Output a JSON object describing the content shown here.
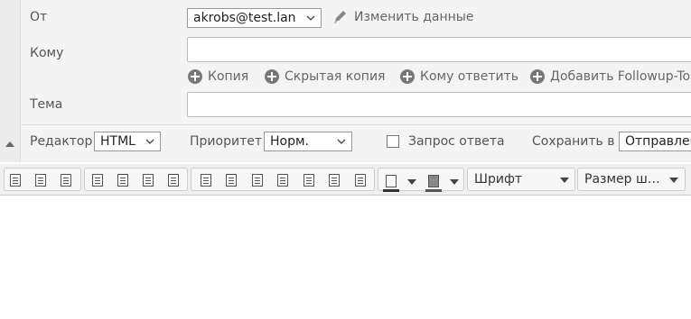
{
  "from": {
    "label": "От",
    "value": "akrobs@test.lan",
    "edit_link": "Изменить данные"
  },
  "to": {
    "label": "Кому",
    "value": ""
  },
  "recipient_links": [
    "Копия",
    "Скрытая копия",
    "Кому ответить",
    "Добавить Followup-To"
  ],
  "subject": {
    "label": "Тема",
    "value": ""
  },
  "options": {
    "editor_label": "Редактор",
    "editor_value": "HTML",
    "priority_label": "Приоритет",
    "priority_value": "Норм.",
    "receipt_label": "Запрос ответа",
    "receipt_checked": false,
    "save_label": "Сохранить в",
    "save_value": "Отправленные"
  },
  "toolbar": {
    "font_label": "Шрифт",
    "size_label": "Размер ш…",
    "format_buttons": [
      "bold",
      "italic",
      "underline",
      "align-left",
      "align-center",
      "align-right",
      "align-justify",
      "ltr",
      "rtl",
      "bullet-list",
      "numbered-list",
      "outdent",
      "indent",
      "blockquote",
      "link",
      "image"
    ],
    "text_color": "#333333",
    "bg_color": "#555555"
  },
  "body": {
    "value": ""
  },
  "colors": {
    "form_bg": "#f4f4f4",
    "toolbar_bg": "#f0f0f0"
  }
}
